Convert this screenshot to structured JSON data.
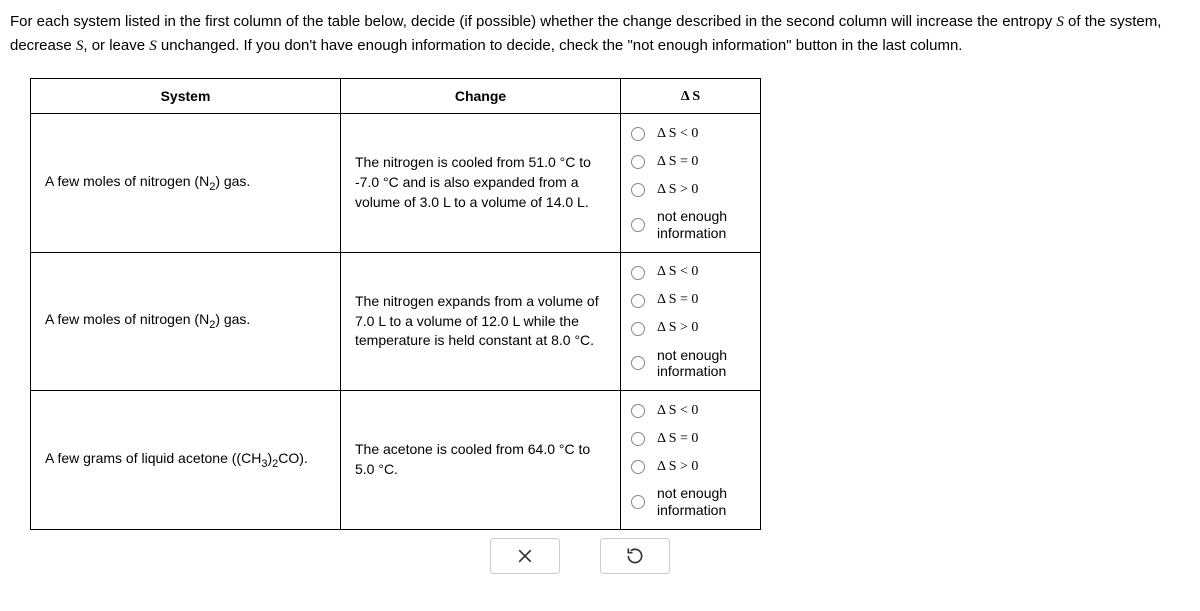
{
  "instructions": {
    "part1": "For each system listed in the first column of the table below, decide (if possible) whether the change described in the second column will increase the entropy ",
    "s1": "S",
    "part2": " of the system, decrease ",
    "s2": "S",
    "part3": ", or leave ",
    "s3": "S",
    "part4": " unchanged. If you don't have enough information to decide, check the \"not enough information\" button in the last column."
  },
  "headers": {
    "system": "System",
    "change": "Change",
    "ds": "Δ S"
  },
  "rows": [
    {
      "system_pre": "A few moles of nitrogen (N",
      "system_sub": "2",
      "system_post": ") gas.",
      "change": "The nitrogen is cooled from 51.0 °C to -7.0 °C and is also expanded from a volume of 3.0 L to a volume of 14.0 L."
    },
    {
      "system_pre": "A few moles of nitrogen (N",
      "system_sub": "2",
      "system_post": ") gas.",
      "change": "The nitrogen expands from a volume of 7.0 L to a volume of 12.0 L while the temperature is held constant at 8.0 °C."
    },
    {
      "system_pre": "A few grams of liquid acetone ((CH",
      "system_sub": "3",
      "system_post": ")",
      "system_sub2": "2",
      "system_post2": "CO).",
      "change": "The acetone is cooled from 64.0 °C to 5.0 °C."
    }
  ],
  "options": {
    "lt": "Δ S < 0",
    "eq": "Δ S = 0",
    "gt": "Δ S > 0",
    "nei": "not enough information"
  },
  "icons": {
    "close": "close-icon",
    "reset": "reset-icon"
  }
}
